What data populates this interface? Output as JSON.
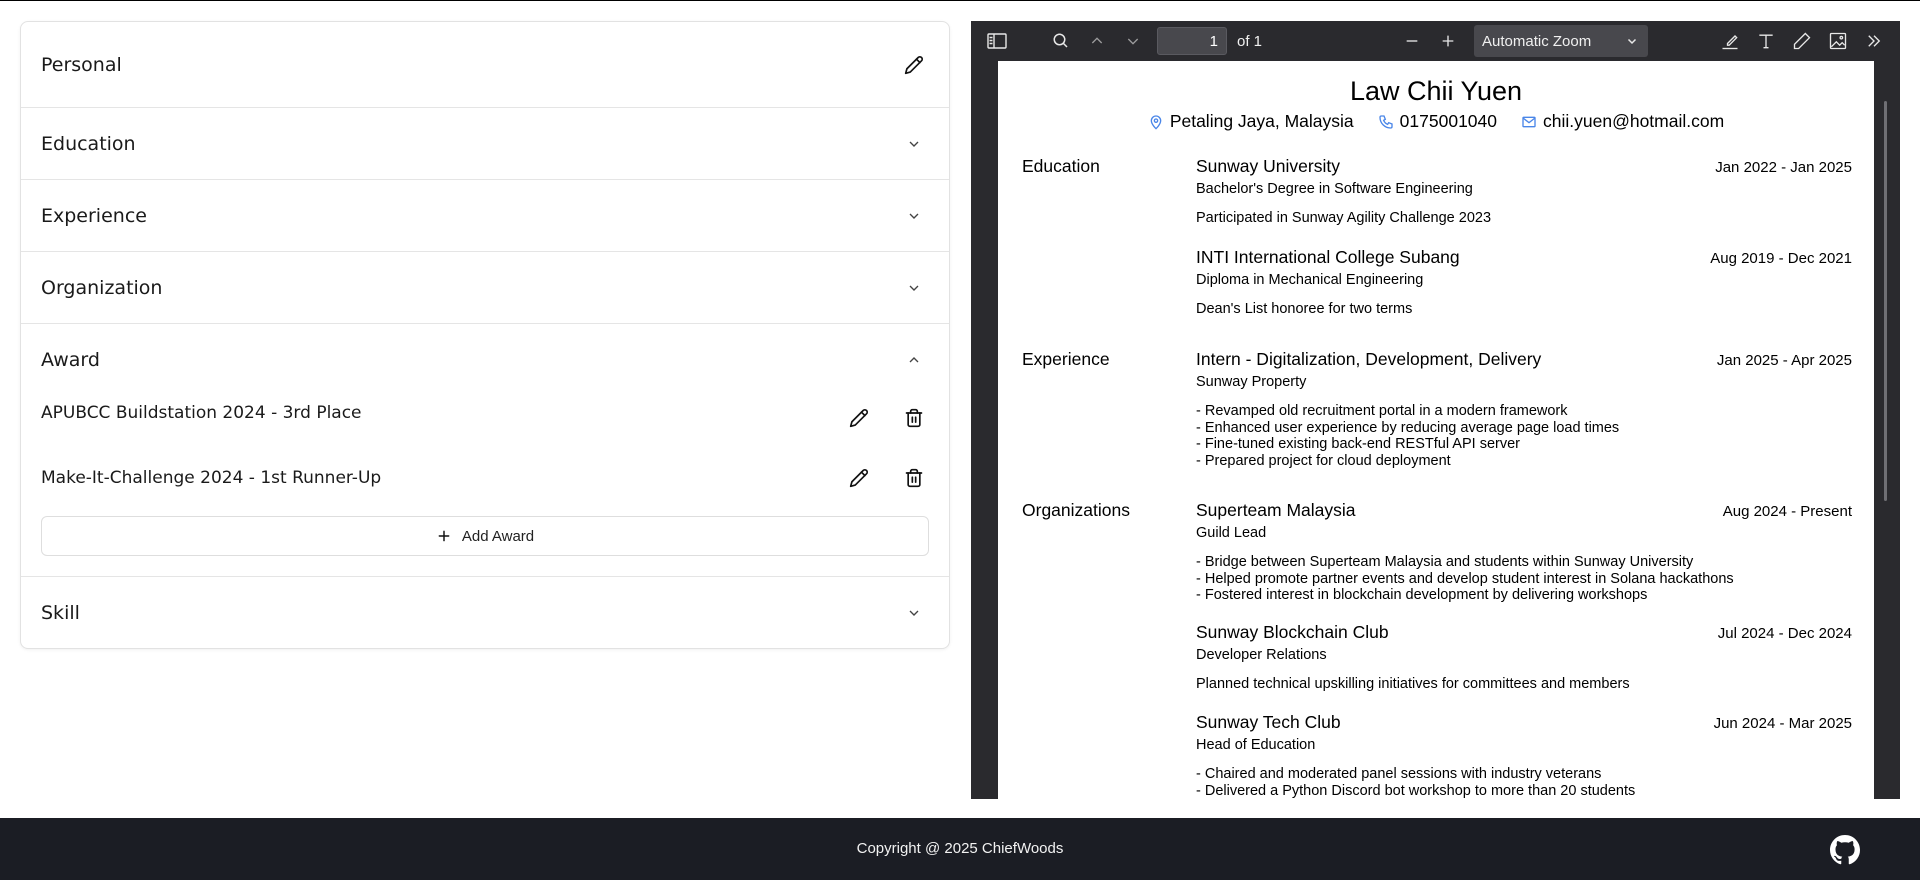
{
  "editor": {
    "sections": {
      "personal": "Personal",
      "education": "Education",
      "experience": "Experience",
      "organization": "Organization",
      "award": "Award",
      "skill": "Skill"
    },
    "awards": [
      {
        "name": "APUBCC Buildstation 2024 - 3rd Place"
      },
      {
        "name": "Make-It-Challenge 2024 - 1st Runner-Up"
      }
    ],
    "add_award_label": "Add Award"
  },
  "viewer": {
    "page_number": "1",
    "page_of": "of 1",
    "zoom": "Automatic Zoom"
  },
  "resume": {
    "name": "Law Chii Yuen",
    "location": "Petaling Jaya, Malaysia",
    "phone": "0175001040",
    "email": "chii.yuen@hotmail.com",
    "education_label": "Education",
    "experience_label": "Experience",
    "organizations_label": "Organizations",
    "education": [
      {
        "title": "Sunway University",
        "date": "Jan 2022 - Jan 2025",
        "sub": "Bachelor's Degree in Software Engineering",
        "desc": "Participated in Sunway Agility Challenge 2023"
      },
      {
        "title": "INTI International College Subang",
        "date": "Aug 2019 - Dec 2021",
        "sub": "Diploma in Mechanical Engineering",
        "desc": "Dean's List honoree for two terms"
      }
    ],
    "experience": [
      {
        "title": "Intern - Digitalization, Development, Delivery",
        "date": "Jan 2025 - Apr 2025",
        "sub": "Sunway Property",
        "bullets": [
          "- Revamped old recruitment portal in a modern framework",
          "- Enhanced user experience by reducing average page load times",
          "- Fine-tuned existing back-end RESTful API server",
          "- Prepared project for cloud deployment"
        ]
      }
    ],
    "organizations": [
      {
        "title": "Superteam Malaysia",
        "date": "Aug 2024 - Present",
        "sub": "Guild Lead",
        "bullets": [
          "- Bridge between Superteam Malaysia and students within Sunway University",
          "- Helped promote partner events and develop student interest in Solana hackathons",
          "- Fostered interest in blockchain development by delivering workshops"
        ]
      },
      {
        "title": "Sunway Blockchain Club",
        "date": "Jul 2024 - Dec 2024",
        "sub": "Developer Relations",
        "bullets": [
          "Planned technical upskilling initiatives for committees and members"
        ]
      },
      {
        "title": "Sunway Tech Club",
        "date": "Jun 2024 - Mar 2025",
        "sub": "Head of Education",
        "bullets": [
          "- Chaired and moderated panel sessions with industry veterans",
          "- Delivered a Python Discord bot workshop to more than 20 students"
        ]
      }
    ]
  },
  "footer": {
    "copyright": "Copyright @ 2025 ChiefWoods"
  },
  "colors": {
    "footer_bg": "#1b1d24",
    "viewer_bg": "#38383d",
    "viewer_toolbar": "#2a2a2e",
    "contact_icon": "#4a86e8"
  },
  "icons": [
    "pencil-icon",
    "trash-icon",
    "chevron-down-icon",
    "chevron-up-icon",
    "plus-icon",
    "sidebar-toggle-icon",
    "search-icon",
    "arrow-up-icon",
    "arrow-down-icon",
    "minus-icon",
    "highlight-icon",
    "text-icon",
    "draw-icon",
    "image-icon",
    "more-tools-icon",
    "location-icon",
    "phone-icon",
    "mail-icon",
    "github-icon"
  ]
}
